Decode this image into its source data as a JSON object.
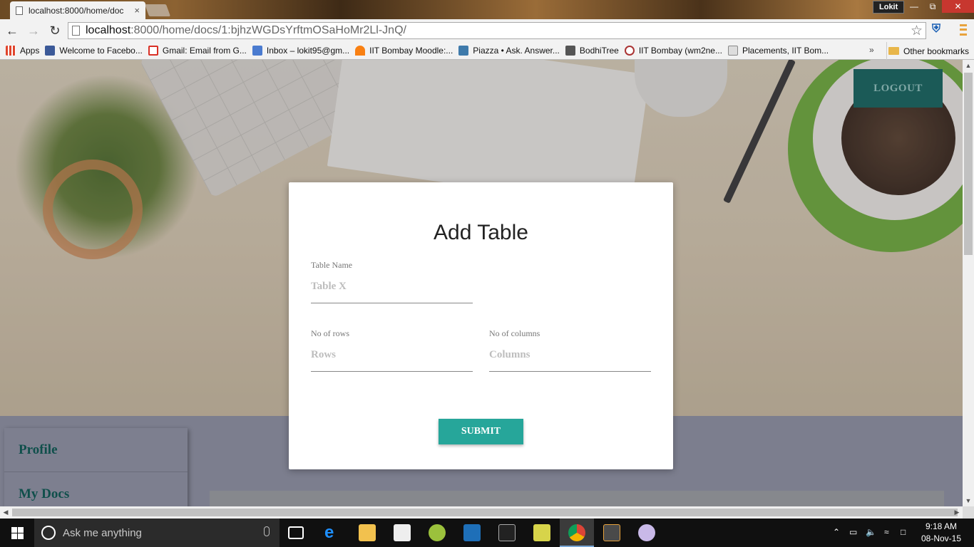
{
  "browser": {
    "tab_title": "localhost:8000/home/doc",
    "tab_close": "×",
    "profile_name": "Lokit",
    "url_host": "localhost",
    "url_path": ":8000/home/docs/1:bjhzWGDsYrftmOSaHoMr2Ll-JnQ/",
    "bookmarks": [
      {
        "label": "Apps",
        "icon": "apps-grid-icon",
        "color": "#e0442c"
      },
      {
        "label": "Welcome to Facebo...",
        "icon": "facebook-icon",
        "color": "#3b5998"
      },
      {
        "label": "Gmail: Email from G...",
        "icon": "gmail-icon",
        "color": "#d93025"
      },
      {
        "label": "Inbox – lokit95@gm...",
        "icon": "inbox-icon",
        "color": "#4a7bd0"
      },
      {
        "label": "IIT Bombay Moodle:...",
        "icon": "moodle-icon",
        "color": "#f98012"
      },
      {
        "label": "Piazza • Ask. Answer...",
        "icon": "piazza-icon",
        "color": "#3e7aab"
      },
      {
        "label": "BodhiTree",
        "icon": "bodhitree-icon",
        "color": "#555555"
      },
      {
        "label": "IIT Bombay (wm2ne...",
        "icon": "iitb-icon",
        "color": "#a33"
      },
      {
        "label": "Placements, IIT Bom...",
        "icon": "placements-icon",
        "color": "#888888"
      }
    ],
    "bookmarks_more": "»",
    "other_bookmarks": "Other bookmarks"
  },
  "page": {
    "logout_label": "LOGOUT",
    "sidebar": [
      {
        "label": "Profile"
      },
      {
        "label": "My Docs"
      }
    ],
    "modal": {
      "title": "Add Table",
      "table_name_label": "Table Name",
      "table_name_placeholder": "Table X",
      "rows_label": "No of rows",
      "rows_placeholder": "Rows",
      "cols_label": "No of columns",
      "cols_placeholder": "Columns",
      "submit_label": "SUBMIT"
    },
    "accent_color": "#26a69a"
  },
  "taskbar": {
    "search_placeholder": "Ask me anything",
    "time": "9:18 AM",
    "date": "08-Nov-15"
  }
}
